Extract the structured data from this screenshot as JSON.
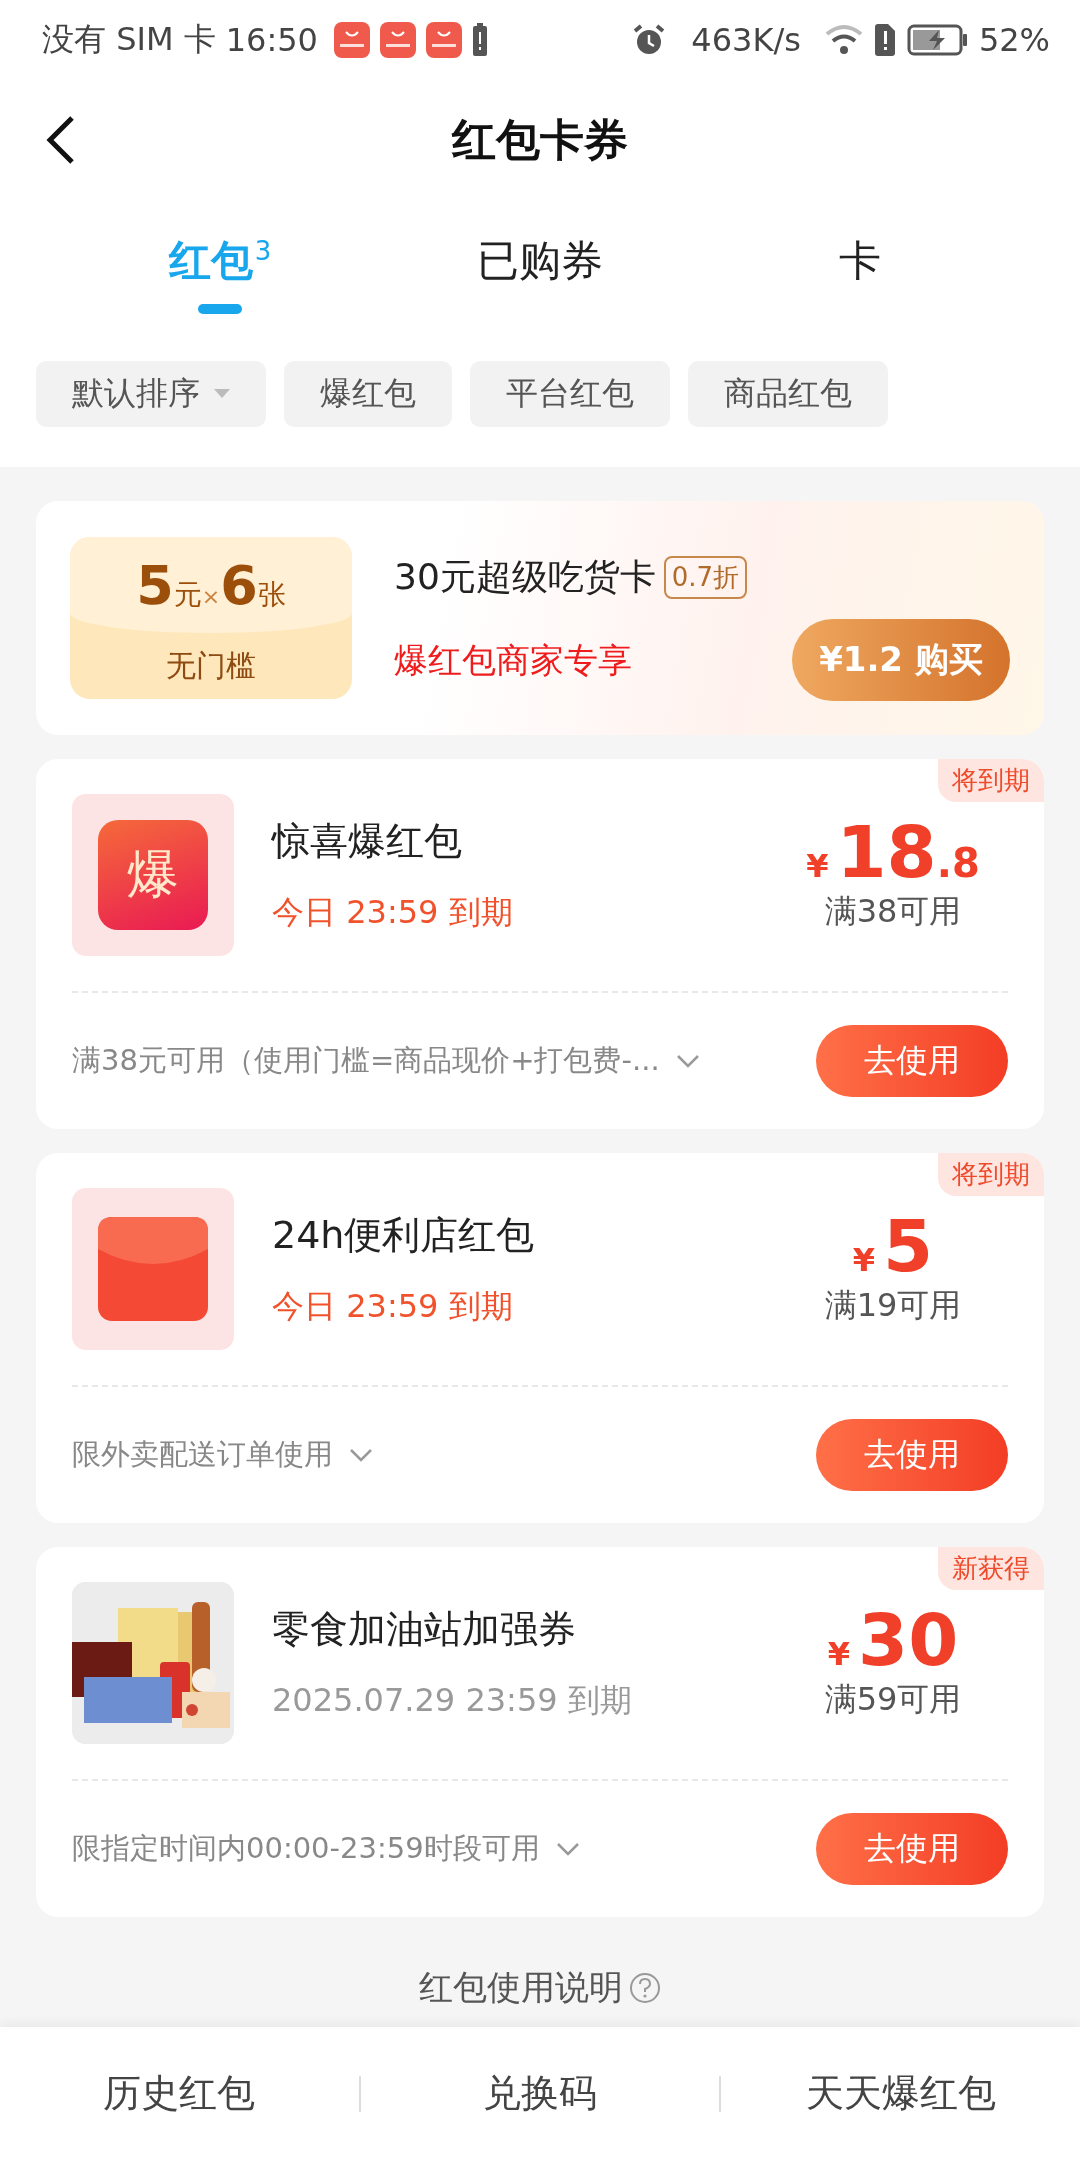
{
  "status_bar": {
    "carrier": "没有 SIM 卡",
    "time": "16:50",
    "speed": "463K/s",
    "battery": "52%"
  },
  "header": {
    "title": "红包卡券"
  },
  "tabs": [
    {
      "label": "红包",
      "count": "3",
      "selected": true
    },
    {
      "label": "已购券",
      "selected": false
    },
    {
      "label": "卡",
      "selected": false
    }
  ],
  "filters": [
    {
      "label": "默认排序",
      "kind": "dropdown"
    },
    {
      "label": "爆红包",
      "kind": "chip"
    },
    {
      "label": "平台红包",
      "kind": "chip"
    },
    {
      "label": "商品红包",
      "kind": "chip"
    }
  ],
  "promo": {
    "amount": "5",
    "unit": "元",
    "times": "×",
    "count": "6",
    "count_unit": "张",
    "threshold": "无门槛",
    "title": "30元超级吃货卡",
    "discount": "0.7折",
    "subtitle": "爆红包商家专享",
    "button": "¥1.2 购买"
  },
  "coupons": [
    {
      "kind": "bao",
      "icon_label": "爆",
      "tag": "将到期",
      "title": "惊喜爆红包",
      "expiry": "今日 23:59 到期",
      "urgent": true,
      "currency": "¥",
      "amount": "18",
      "decimal": ".8",
      "condition": "满38可用",
      "note": "满38元可用（使用门槛=商品现价+打包费-...",
      "button": "去使用"
    },
    {
      "kind": "envelope",
      "tag": "将到期",
      "title": "24h便利店红包",
      "expiry": "今日 23:59 到期",
      "urgent": true,
      "currency": "¥",
      "amount": "5",
      "condition": "满19可用",
      "note": "限外卖配送订单使用",
      "button": "去使用"
    },
    {
      "kind": "picture",
      "tag": "新获得",
      "title": "零食加油站加强券",
      "expiry": "2025.07.29 23:59 到期",
      "urgent": false,
      "currency": "¥",
      "amount": "30",
      "condition": "满59可用",
      "note": "限指定时间内00:00-23:59时段可用",
      "button": "去使用"
    }
  ],
  "help_link": "红包使用说明",
  "bottom_bar": [
    "历史红包",
    "兑换码",
    "天天爆红包"
  ]
}
